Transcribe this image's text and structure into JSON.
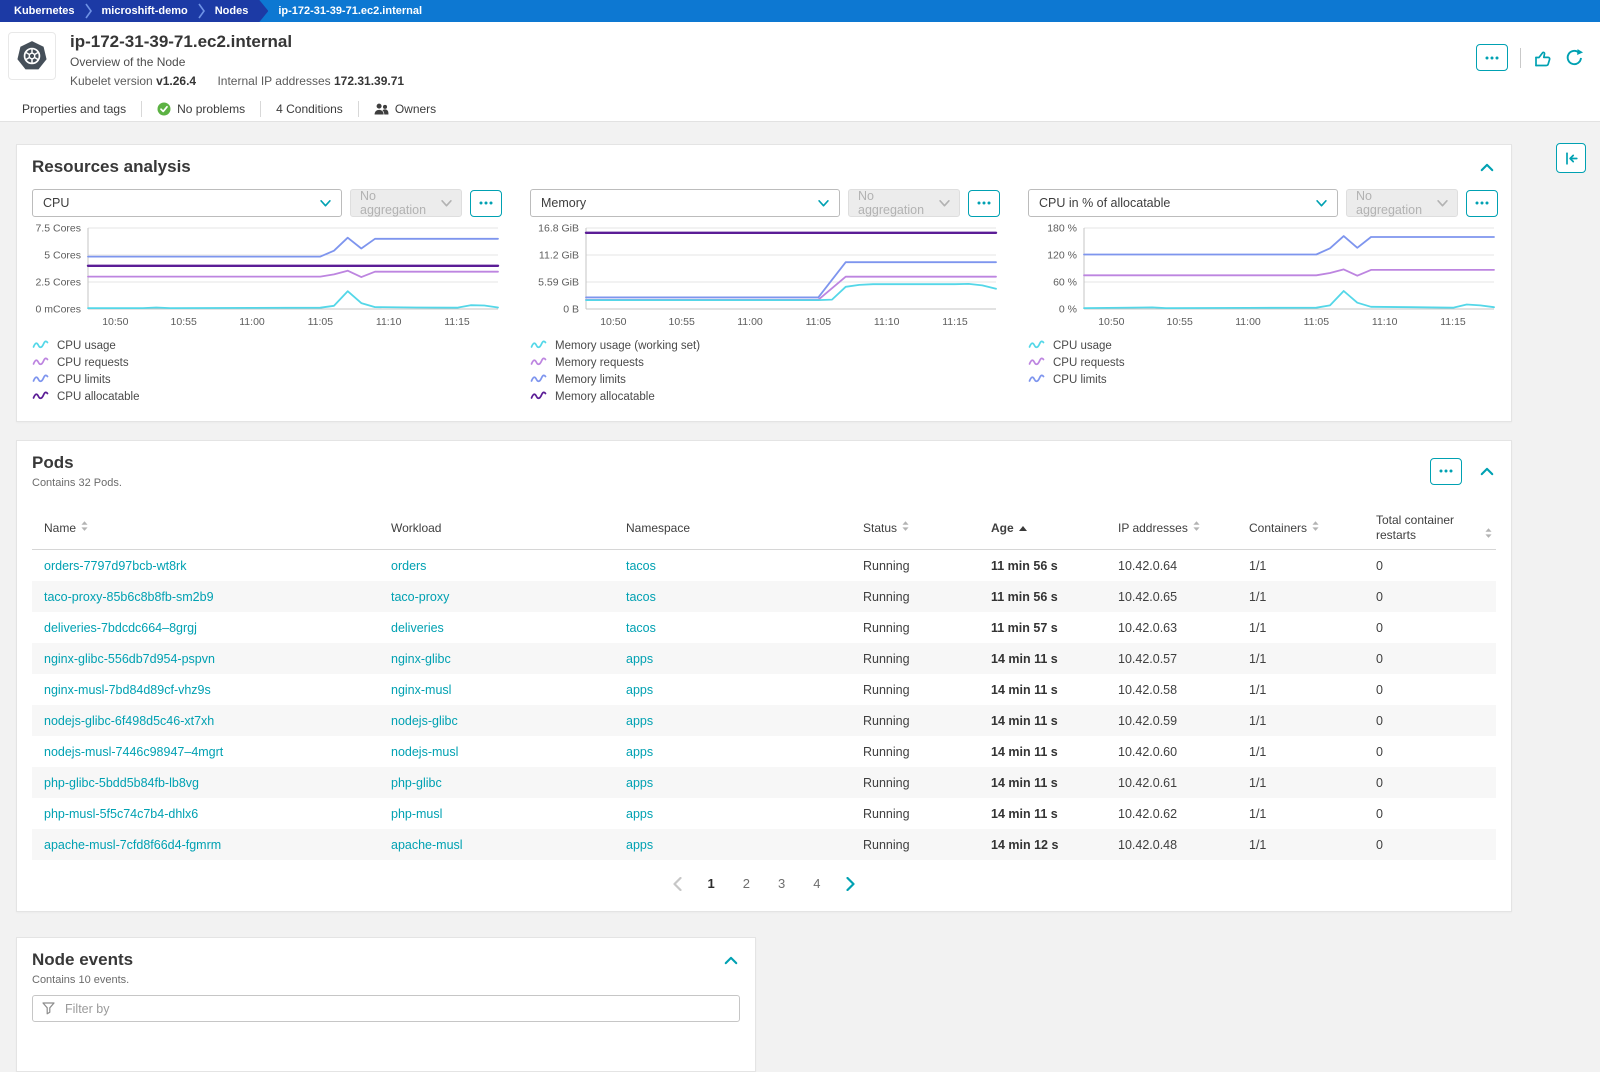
{
  "colors": {
    "accent_teal": "#00a1b2",
    "breadcrumb_navy": "#1c3aa5",
    "breadcrumb_blue": "#0d78d2",
    "status_green": "#5cb243",
    "series_usage": "#54d7e8",
    "series_requests": "#bd85e0",
    "series_limits": "#7e95ee",
    "series_allocatable": "#5b1d96"
  },
  "breadcrumb": {
    "items": [
      "Kubernetes",
      "microshift-demo",
      "Nodes"
    ],
    "current": "ip-172-31-39-71.ec2.internal"
  },
  "header": {
    "title": "ip-172-31-39-71.ec2.internal",
    "subtitle": "Overview of the Node",
    "kubelet_label": "Kubelet version",
    "kubelet_version": "v1.26.4",
    "ip_label": "Internal IP addresses",
    "ip_value": "172.31.39.71"
  },
  "tabs": [
    {
      "label": "Properties and tags",
      "icon": null
    },
    {
      "label": "No problems",
      "icon": "check"
    },
    {
      "label": "4 Conditions",
      "icon": null
    },
    {
      "label": "Owners",
      "icon": "people"
    }
  ],
  "resources": {
    "title": "Resources analysis",
    "no_aggregation_label": "No aggregation"
  },
  "chart_data": [
    {
      "type": "line",
      "metric_selector": "CPU",
      "y_ticks": [
        "7.5 Cores",
        "5 Cores",
        "2.5 Cores",
        "0 mCores"
      ],
      "y_max": 7.5,
      "x_max": 30,
      "x_ticks": [
        {
          "m": 2,
          "label": "10:50"
        },
        {
          "m": 7,
          "label": "10:55"
        },
        {
          "m": 12,
          "label": "11:00"
        },
        {
          "m": 17,
          "label": "11:05"
        },
        {
          "m": 22,
          "label": "11:10"
        },
        {
          "m": 27,
          "label": "11:15"
        }
      ],
      "series": [
        {
          "name": "CPU limits",
          "color": "#7e95ee",
          "width": 1.8,
          "points": [
            [
              0,
              4.85
            ],
            [
              17,
              4.85
            ],
            [
              18,
              5.4
            ],
            [
              19,
              6.6
            ],
            [
              20,
              5.6
            ],
            [
              21,
              6.5
            ],
            [
              30,
              6.5
            ]
          ]
        },
        {
          "name": "CPU allocatable",
          "color": "#5b1d96",
          "width": 2.4,
          "points": [
            [
              0,
              4.0
            ],
            [
              30,
              4.0
            ]
          ]
        },
        {
          "name": "CPU requests",
          "color": "#bd85e0",
          "width": 1.8,
          "points": [
            [
              0,
              3.0
            ],
            [
              17,
              3.0
            ],
            [
              18,
              3.2
            ],
            [
              19,
              3.55
            ],
            [
              20,
              2.95
            ],
            [
              21,
              3.45
            ],
            [
              30,
              3.45
            ]
          ]
        },
        {
          "name": "CPU usage",
          "color": "#54d7e8",
          "width": 1.8,
          "points": [
            [
              0,
              0.08
            ],
            [
              4,
              0.08
            ],
            [
              5,
              0.14
            ],
            [
              6,
              0.08
            ],
            [
              12,
              0.1
            ],
            [
              17,
              0.12
            ],
            [
              18,
              0.3
            ],
            [
              19,
              1.65
            ],
            [
              20,
              0.55
            ],
            [
              21,
              0.18
            ],
            [
              24,
              0.14
            ],
            [
              27,
              0.12
            ],
            [
              28,
              0.35
            ],
            [
              29,
              0.32
            ],
            [
              30,
              0.14
            ]
          ]
        }
      ],
      "legend": [
        {
          "label": "CPU usage",
          "color": "#54d7e8"
        },
        {
          "label": "CPU requests",
          "color": "#bd85e0"
        },
        {
          "label": "CPU limits",
          "color": "#7e95ee"
        },
        {
          "label": "CPU allocatable",
          "color": "#5b1d96"
        }
      ]
    },
    {
      "type": "line",
      "metric_selector": "Memory",
      "y_ticks": [
        "16.8 GiB",
        "11.2 GiB",
        "5.59 GiB",
        "0 B"
      ],
      "y_max": 16.8,
      "x_max": 30,
      "x_ticks": [
        {
          "m": 2,
          "label": "10:50"
        },
        {
          "m": 7,
          "label": "10:55"
        },
        {
          "m": 12,
          "label": "11:00"
        },
        {
          "m": 17,
          "label": "11:05"
        },
        {
          "m": 22,
          "label": "11:10"
        },
        {
          "m": 27,
          "label": "11:15"
        }
      ],
      "series": [
        {
          "name": "Memory allocatable",
          "color": "#5b1d96",
          "width": 2.4,
          "points": [
            [
              0,
              15.8
            ],
            [
              30,
              15.8
            ]
          ]
        },
        {
          "name": "Memory limits",
          "color": "#7e95ee",
          "width": 1.8,
          "points": [
            [
              0,
              2.4
            ],
            [
              17,
              2.4
            ],
            [
              19,
              9.7
            ],
            [
              30,
              9.7
            ]
          ]
        },
        {
          "name": "Memory requests",
          "color": "#bd85e0",
          "width": 1.8,
          "points": [
            [
              0,
              1.9
            ],
            [
              17,
              1.9
            ],
            [
              19,
              6.7
            ],
            [
              30,
              6.7
            ]
          ]
        },
        {
          "name": "Memory usage (working set)",
          "color": "#54d7e8",
          "width": 1.8,
          "points": [
            [
              0,
              1.85
            ],
            [
              17,
              1.85
            ],
            [
              18,
              1.95
            ],
            [
              19,
              4.6
            ],
            [
              20,
              5.0
            ],
            [
              21,
              5.15
            ],
            [
              27,
              5.15
            ],
            [
              28,
              5.2
            ],
            [
              29,
              4.9
            ],
            [
              30,
              4.2
            ]
          ]
        }
      ],
      "legend": [
        {
          "label": "Memory usage (working set)",
          "color": "#54d7e8"
        },
        {
          "label": "Memory requests",
          "color": "#bd85e0"
        },
        {
          "label": "Memory limits",
          "color": "#7e95ee"
        },
        {
          "label": "Memory allocatable",
          "color": "#5b1d96"
        }
      ]
    },
    {
      "type": "line",
      "metric_selector": "CPU in % of allocatable",
      "y_ticks": [
        "180 %",
        "120 %",
        "60 %",
        "0 %"
      ],
      "y_max": 180,
      "x_max": 30,
      "x_ticks": [
        {
          "m": 2,
          "label": "10:50"
        },
        {
          "m": 7,
          "label": "10:55"
        },
        {
          "m": 12,
          "label": "11:00"
        },
        {
          "m": 17,
          "label": "11:05"
        },
        {
          "m": 22,
          "label": "11:10"
        },
        {
          "m": 27,
          "label": "11:15"
        }
      ],
      "series": [
        {
          "name": "CPU limits",
          "color": "#7e95ee",
          "width": 1.8,
          "points": [
            [
              0,
              121
            ],
            [
              17,
              121
            ],
            [
              18,
              135
            ],
            [
              19,
              162
            ],
            [
              20,
              136
            ],
            [
              21,
              160
            ],
            [
              30,
              160
            ]
          ]
        },
        {
          "name": "CPU requests",
          "color": "#bd85e0",
          "width": 1.8,
          "points": [
            [
              0,
              75
            ],
            [
              17,
              75
            ],
            [
              18,
              80
            ],
            [
              19,
              88
            ],
            [
              20,
              74
            ],
            [
              21,
              87
            ],
            [
              30,
              87
            ]
          ]
        },
        {
          "name": "CPU usage",
          "color": "#54d7e8",
          "width": 1.8,
          "points": [
            [
              0,
              2
            ],
            [
              5,
              3.5
            ],
            [
              6,
              2
            ],
            [
              12,
              2.5
            ],
            [
              17,
              3
            ],
            [
              18,
              8
            ],
            [
              19,
              40
            ],
            [
              20,
              14
            ],
            [
              21,
              5
            ],
            [
              24,
              4
            ],
            [
              27,
              3
            ],
            [
              28,
              10
            ],
            [
              29,
              8
            ],
            [
              30,
              4
            ]
          ]
        }
      ],
      "legend": [
        {
          "label": "CPU usage",
          "color": "#54d7e8"
        },
        {
          "label": "CPU requests",
          "color": "#bd85e0"
        },
        {
          "label": "CPU limits",
          "color": "#7e95ee"
        }
      ]
    }
  ],
  "pods": {
    "title": "Pods",
    "subtitle": "Contains 32 Pods.",
    "columns": [
      {
        "label": "Name",
        "sort": "both"
      },
      {
        "label": "Workload",
        "sort": null
      },
      {
        "label": "Namespace",
        "sort": null
      },
      {
        "label": "Status",
        "sort": "both"
      },
      {
        "label": "Age",
        "sort": "asc"
      },
      {
        "label": "IP addresses",
        "sort": "both"
      },
      {
        "label": "Containers",
        "sort": "both"
      },
      {
        "label": "Total container restarts",
        "sort": "both-right"
      }
    ],
    "rows": [
      {
        "name": "orders-7797d97bcb-wt8rk",
        "workload": "orders",
        "namespace": "tacos",
        "status": "Running",
        "age": "11 min 56 s",
        "ip": "10.42.0.64",
        "containers": "1/1",
        "restarts": "0"
      },
      {
        "name": "taco-proxy-85b6c8b8fb-sm2b9",
        "workload": "taco-proxy",
        "namespace": "tacos",
        "status": "Running",
        "age": "11 min 56 s",
        "ip": "10.42.0.65",
        "containers": "1/1",
        "restarts": "0"
      },
      {
        "name": "deliveries-7bdcdc664–8grgj",
        "workload": "deliveries",
        "namespace": "tacos",
        "status": "Running",
        "age": "11 min 57 s",
        "ip": "10.42.0.63",
        "containers": "1/1",
        "restarts": "0"
      },
      {
        "name": "nginx-glibc-556db7d954-pspvn",
        "workload": "nginx-glibc",
        "namespace": "apps",
        "status": "Running",
        "age": "14 min 11 s",
        "ip": "10.42.0.57",
        "containers": "1/1",
        "restarts": "0"
      },
      {
        "name": "nginx-musl-7bd84d89cf-vhz9s",
        "workload": "nginx-musl",
        "namespace": "apps",
        "status": "Running",
        "age": "14 min 11 s",
        "ip": "10.42.0.58",
        "containers": "1/1",
        "restarts": "0"
      },
      {
        "name": "nodejs-glibc-6f498d5c46-xt7xh",
        "workload": "nodejs-glibc",
        "namespace": "apps",
        "status": "Running",
        "age": "14 min 11 s",
        "ip": "10.42.0.59",
        "containers": "1/1",
        "restarts": "0"
      },
      {
        "name": "nodejs-musl-7446c98947–4mgrt",
        "workload": "nodejs-musl",
        "namespace": "apps",
        "status": "Running",
        "age": "14 min 11 s",
        "ip": "10.42.0.60",
        "containers": "1/1",
        "restarts": "0"
      },
      {
        "name": "php-glibc-5bdd5b84fb-lb8vg",
        "workload": "php-glibc",
        "namespace": "apps",
        "status": "Running",
        "age": "14 min 11 s",
        "ip": "10.42.0.61",
        "containers": "1/1",
        "restarts": "0"
      },
      {
        "name": "php-musl-5f5c74c7b4-dhlx6",
        "workload": "php-musl",
        "namespace": "apps",
        "status": "Running",
        "age": "14 min 11 s",
        "ip": "10.42.0.62",
        "containers": "1/1",
        "restarts": "0"
      },
      {
        "name": "apache-musl-7cfd8f66d4-fgmrm",
        "workload": "apache-musl",
        "namespace": "apps",
        "status": "Running",
        "age": "14 min 12 s",
        "ip": "10.42.0.48",
        "containers": "1/1",
        "restarts": "0"
      }
    ],
    "pagination": {
      "pages": [
        "1",
        "2",
        "3",
        "4"
      ],
      "active": "1",
      "prev_enabled": false,
      "next_enabled": true
    }
  },
  "node_events": {
    "title": "Node events",
    "subtitle": "Contains 10 events.",
    "filter_placeholder": "Filter by"
  }
}
